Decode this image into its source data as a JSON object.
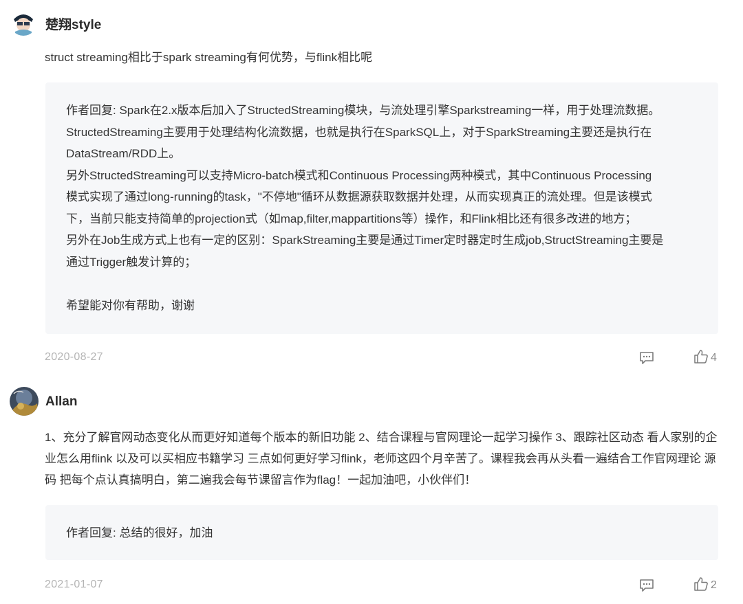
{
  "comments": [
    {
      "username": "楚翔style",
      "text": "struct streaming相比于spark streaming有何优势，与flink相比呢",
      "reply": "作者回复: Spark在2.x版本后加入了StructedStreaming模块，与流处理引擎Sparkstreaming一样，用于处理流数据。\nStructedStreaming主要用于处理结构化流数据，也就是执行在SparkSQL上，对于SparkStreaming主要还是执行在\nDataStream/RDD上。\n另外StructedStreaming可以支持Micro-batch模式和Continuous Processing两种模式，其中Continuous Processing\n模式实现了通过long-running的task，\"不停地\"循环从数据源获取数据并处理，从而实现真正的流处理。但是该模式\n下，当前只能支持简单的projection式（如map,filter,mappartitions等）操作，和Flink相比还有很多改进的地方；\n另外在Job生成方式上也有一定的区别：SparkStreaming主要是通过Timer定时器定时生成job,StructStreaming主要是\n通过Trigger触发计算的；\n\n希望能对你有帮助，谢谢",
      "date": "2020-08-27",
      "likes": "4"
    },
    {
      "username": "Allan",
      "text": "1、充分了解官网动态变化从而更好知道每个版本的新旧功能 2、结合课程与官网理论一起学习操作 3、跟踪社区动态 看人家别的企业怎么用flink 以及可以买相应书籍学习 三点如何更好学习flink，老师这四个月辛苦了。课程我会再从头看一遍结合工作官网理论 源码 把每个点认真搞明白，第二遍我会每节课留言作为flag！一起加油吧，小伙伴们！",
      "reply": "作者回复: 总结的很好，加油",
      "date": "2021-01-07",
      "likes": "2"
    }
  ],
  "icons": {
    "reply": "comment-bubble-icon",
    "like": "thumbs-up-icon"
  },
  "colors": {
    "reply_bg": "#f6f7f9",
    "date": "#b5b5b5"
  }
}
